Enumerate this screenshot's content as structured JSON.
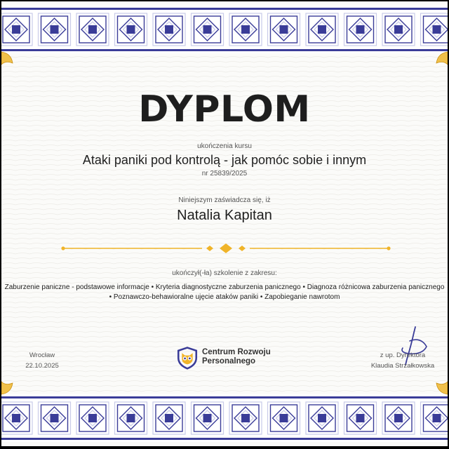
{
  "diploma": {
    "title": "DYPLOM",
    "completion_label": "ukończenia kursu",
    "course_name": "Ataki paniki pod kontrolą - jak pomóc sobie i innym",
    "certificate_number": "nr 25839/2025",
    "certify_text": "Niniejszym zaświadcza się, iż",
    "recipient_name": "Natalia Kapitan",
    "scope_label": "ukończył(-ła) szkolenie z zakresu:",
    "topics_line1": "Zaburzenie paniczne - podstawowe informacje • Kryteria diagnostyczne zaburzenia panicznego • Diagnoza różnicowa zaburzenia panicznego",
    "topics_line2": "• Poznawczo-behawioralne ujęcie ataków paniki • Zapobieganie nawrotom"
  },
  "footer": {
    "city": "Wrocław",
    "date": "22.10.2025",
    "organization_line1": "Centrum Rozwoju",
    "organization_line2": "Personalnego",
    "director_label": "z up. Dyrektora",
    "director_name": "Klaudia Strzałkowska"
  },
  "colors": {
    "border_blue": "#3a3c98",
    "border_light": "#c9cbe8",
    "gold": "#f0b429",
    "text_dark": "#1f1f1f"
  },
  "icons": {
    "logo": "owl-shield-icon",
    "divider_center": "diamond-icon",
    "corner": "gold-leaf-icon"
  }
}
